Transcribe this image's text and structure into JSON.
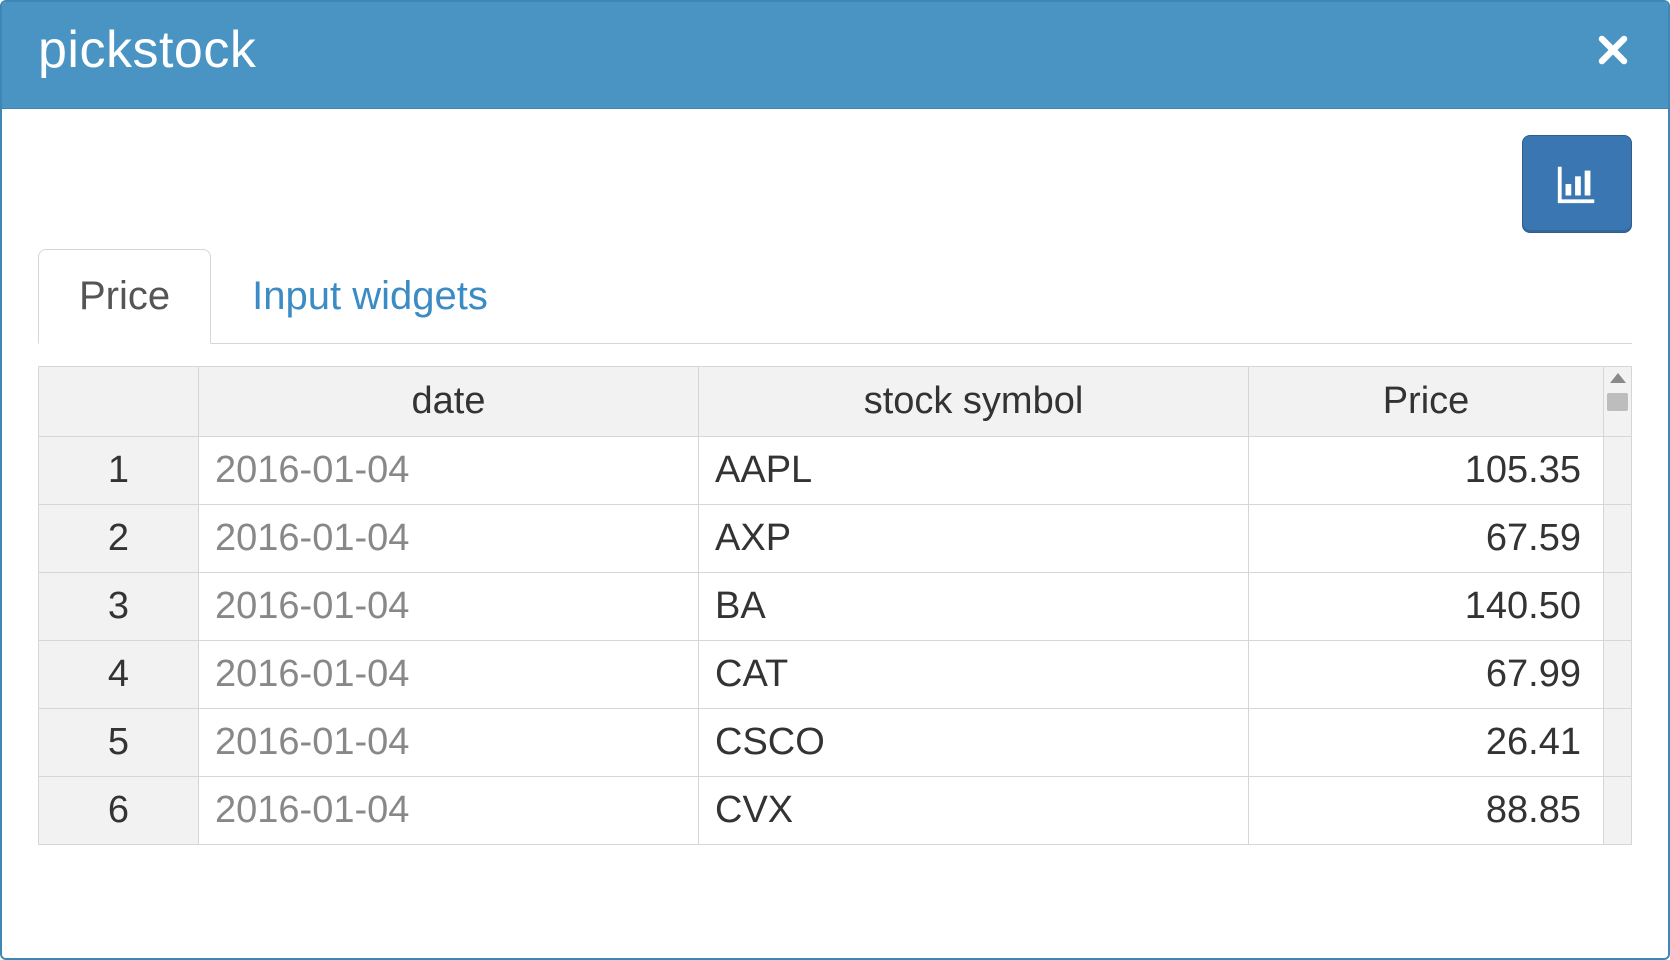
{
  "panel": {
    "title": "pickstock"
  },
  "tabs": [
    {
      "label": "Price",
      "active": true
    },
    {
      "label": "Input widgets",
      "active": false
    }
  ],
  "table": {
    "headers": {
      "rownum": "",
      "date": "date",
      "symbol": "stock symbol",
      "price": "Price"
    },
    "rows": [
      {
        "n": "1",
        "date": "2016-01-04",
        "symbol": "AAPL",
        "price": "105.35"
      },
      {
        "n": "2",
        "date": "2016-01-04",
        "symbol": "AXP",
        "price": "67.59"
      },
      {
        "n": "3",
        "date": "2016-01-04",
        "symbol": "BA",
        "price": "140.50"
      },
      {
        "n": "4",
        "date": "2016-01-04",
        "symbol": "CAT",
        "price": "67.99"
      },
      {
        "n": "5",
        "date": "2016-01-04",
        "symbol": "CSCO",
        "price": "26.41"
      },
      {
        "n": "6",
        "date": "2016-01-04",
        "symbol": "CVX",
        "price": "88.85"
      }
    ]
  },
  "colors": {
    "header_bg": "#4a94c3",
    "accent": "#3a76b1",
    "link": "#3b8bc4",
    "border": "#d6d6d6"
  }
}
